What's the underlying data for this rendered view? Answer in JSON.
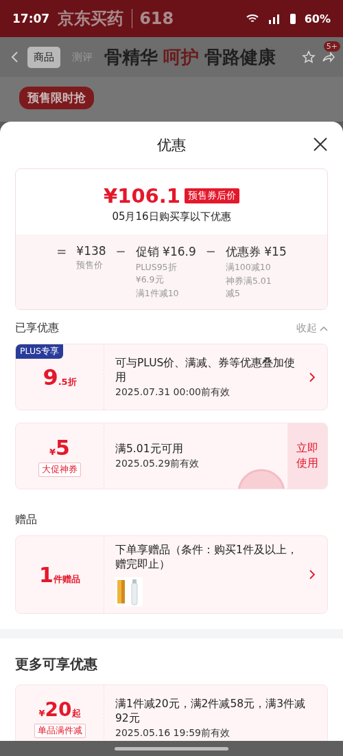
{
  "status_bar": {
    "time": "17:07",
    "battery": "60%"
  },
  "backdrop": {
    "brand": "京东买药",
    "event": "618",
    "tabs": [
      {
        "label": "商品",
        "selected": true
      },
      {
        "label": "测评",
        "selected": false
      }
    ],
    "headline": [
      {
        "text": "骨精华",
        "accent": false
      },
      {
        "text": "呵护",
        "accent": true
      },
      {
        "text": "骨路健康",
        "accent": false
      }
    ],
    "cart_badge": "5+",
    "promo_tag": "预售限时抢"
  },
  "sheet": {
    "title": "优惠"
  },
  "price_card": {
    "price": "¥106.1",
    "price_tag": "预售券后价",
    "subtitle": "05月16日购买享以下优惠",
    "breakdown": [
      {
        "operator": "=",
        "amount": "¥138",
        "notes": [
          "预售价"
        ]
      },
      {
        "operator": "−",
        "amount": "促销 ¥16.9",
        "notes": [
          "PLUS95折¥6.9元",
          "满1件减10"
        ]
      },
      {
        "operator": "−",
        "amount": "优惠券 ¥15",
        "notes": [
          "满100减10",
          "神券满5.01减5"
        ]
      }
    ]
  },
  "sections": [
    {
      "title": "已享优惠",
      "emphasis": false,
      "toggle": "收起",
      "expanded": true,
      "cards": [
        {
          "kind": "discount",
          "tag": "PLUS专享",
          "amount": "9",
          "suffix": ".5折",
          "description": "可与PLUS价、满减、券等优惠叠加使用",
          "validity": "2025.07.31 00:00前有效",
          "arrow": true
        },
        {
          "kind": "coupon",
          "prefix": "¥",
          "amount": "5",
          "label": "大促神券",
          "description": "满5.01元可用",
          "validity": "2025.05.29前有效",
          "action": "立即使用",
          "claimed": true,
          "arrow": false
        }
      ]
    },
    {
      "title": "赠品",
      "emphasis": false,
      "cards": [
        {
          "kind": "gift",
          "amount": "1",
          "suffix": "件赠品",
          "description": "下单享赠品（条件：购买1件及以上，赠完即止）",
          "gift_picture": true,
          "arrow": true
        }
      ]
    },
    {
      "title": "更多可享优惠",
      "emphasis": true,
      "divider": true,
      "cards": [
        {
          "kind": "promo",
          "prefix": "¥",
          "amount": "20",
          "suffix": "起",
          "label": "单品满件减",
          "description": "满1件减20元，满2件减58元，满3件减92元",
          "validity": "2025.05.16 19:59前有效",
          "arrow": false
        }
      ]
    }
  ]
}
